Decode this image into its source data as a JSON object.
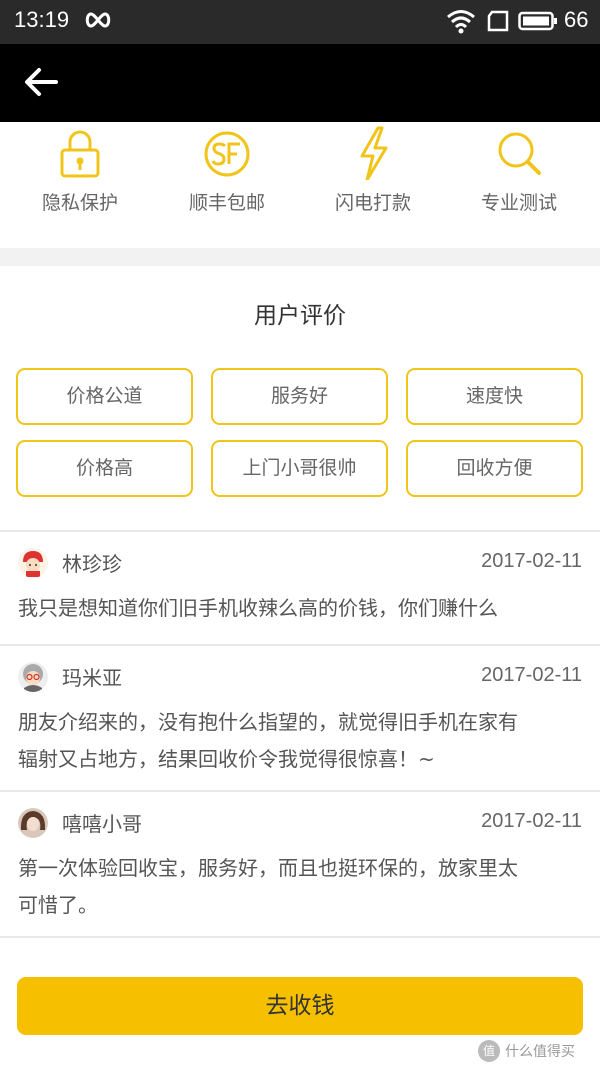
{
  "status_bar": {
    "time": "13:19",
    "battery": "66"
  },
  "features": [
    {
      "label": "隐私保护",
      "icon": "lock-icon"
    },
    {
      "label": "顺丰包邮",
      "icon": "sf-express-icon"
    },
    {
      "label": "闪电打款",
      "icon": "lightning-icon"
    },
    {
      "label": "专业测试",
      "icon": "magnifier-icon"
    }
  ],
  "reviews_section": {
    "title": "用户评价",
    "tags": [
      "价格公道",
      "服务好",
      "速度快",
      "价格高",
      "上门小哥很帅",
      "回收方便"
    ]
  },
  "reviews": [
    {
      "name": "林珍珍",
      "date": "2017-02-11",
      "text": "我只是想知道你们旧手机收辣么高的价钱，你们赚什么"
    },
    {
      "name": "玛米亚",
      "date": "2017-02-11",
      "text_line1": "朋友介绍来的，没有抱什么指望的，就觉得旧手机在家有",
      "text_line2": "辐射又占地方，结果回收价令我觉得很惊喜！~"
    },
    {
      "name": "嘻嘻小哥",
      "date": "2017-02-11",
      "text_line1": "第一次体验回收宝，服务好，而且也挺环保的，放家里太",
      "text_line2": "可惜了。"
    }
  ],
  "cta": {
    "label": "去收钱"
  },
  "watermark": {
    "badge": "值",
    "text": "什么值得买"
  },
  "colors": {
    "accent": "#f6c000",
    "tag_border": "#f0c419",
    "nav": "#000000",
    "status": "#2a2a2a"
  }
}
